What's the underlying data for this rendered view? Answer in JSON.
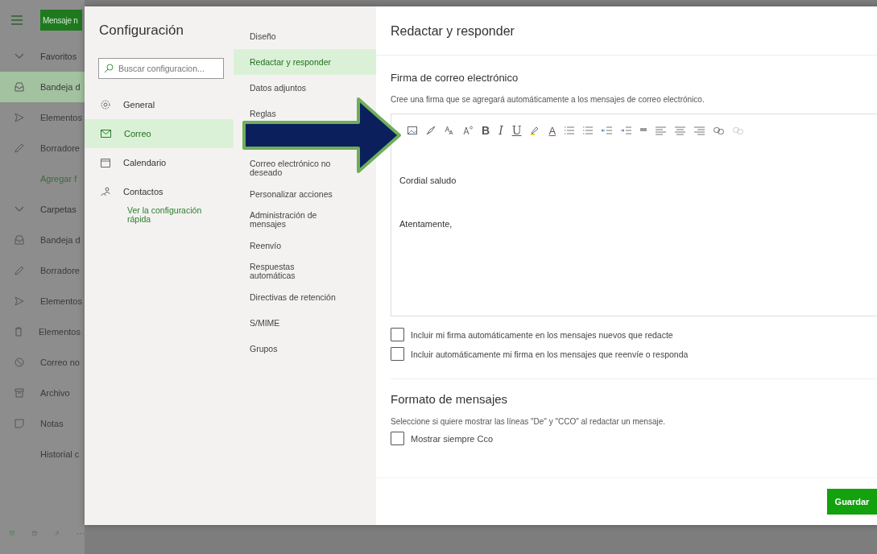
{
  "app": {
    "new_message": "Mensaje n",
    "nav": [
      {
        "kind": "section",
        "label": "Favoritos",
        "selected": false
      },
      {
        "kind": "inbox",
        "label": "Bandeja d",
        "selected": true
      },
      {
        "kind": "sent",
        "label": "Elementos",
        "selected": false
      },
      {
        "kind": "draft",
        "label": "Borradore",
        "selected": false
      },
      {
        "kind": "link",
        "label": "Agregar f",
        "selected": false
      },
      {
        "kind": "section",
        "label": "Carpetas",
        "selected": false
      },
      {
        "kind": "inbox",
        "label": "Bandeja d",
        "selected": false
      },
      {
        "kind": "draft",
        "label": "Borradore",
        "selected": false
      },
      {
        "kind": "sent",
        "label": "Elementos",
        "selected": false
      },
      {
        "kind": "deleted",
        "label": "Elementos",
        "selected": false
      },
      {
        "kind": "junk",
        "label": "Correo no",
        "selected": false
      },
      {
        "kind": "archive",
        "label": "Archivo",
        "selected": false
      },
      {
        "kind": "notes",
        "label": "Notas",
        "selected": false
      },
      {
        "kind": "plain",
        "label": "Historial c",
        "selected": false
      }
    ],
    "bottom_icons": [
      {
        "kind": "mail",
        "selected": true
      },
      {
        "kind": "calendar",
        "selected": false
      },
      {
        "kind": "people",
        "selected": false
      },
      {
        "kind": "more",
        "selected": false
      }
    ],
    "more_label": "···"
  },
  "settings": {
    "title": "Configuración",
    "search": {
      "placeholder": "Buscar configuracion..."
    },
    "categories": [
      {
        "kind": "gear",
        "label": "General",
        "selected": false
      },
      {
        "kind": "mail",
        "label": "Correo",
        "selected": true
      },
      {
        "kind": "calendar",
        "label": "Calendario",
        "selected": false
      },
      {
        "kind": "people",
        "label": "Contactos",
        "selected": false
      }
    ],
    "quick_link": "Ver la configuración rápida",
    "subcategories": [
      {
        "label": "Diseño",
        "selected": false
      },
      {
        "label": "Redactar y responder",
        "selected": true
      },
      {
        "label": "Datos adjuntos",
        "selected": false
      },
      {
        "label": "Reglas",
        "selected": false
      },
      {
        "label": "Correo electrónico no deseado",
        "selected": false
      },
      {
        "label": "Personalizar acciones",
        "selected": false
      },
      {
        "label": "Administración de mensajes",
        "selected": false
      },
      {
        "label": "Reenvío",
        "selected": false
      },
      {
        "label": "Respuestas automáticas",
        "selected": false
      },
      {
        "label": "Directivas de retención",
        "selected": false
      },
      {
        "label": "S/MIME",
        "selected": false
      },
      {
        "label": "Grupos",
        "selected": false
      }
    ]
  },
  "panel": {
    "title": "Redactar y responder",
    "signature": {
      "heading": "Firma de correo electrónico",
      "description": "Cree una firma que se agregará automáticamente a los mensajes de correo electrónico.",
      "toolbar": [
        {
          "kind": "image",
          "disabled": false
        },
        {
          "kind": "brush",
          "disabled": false
        },
        {
          "kind": "fontsize",
          "disabled": false
        },
        {
          "kind": "superscript",
          "disabled": false
        },
        {
          "kind": "bold",
          "label": "B",
          "disabled": false
        },
        {
          "kind": "italic",
          "label": "I",
          "disabled": false
        },
        {
          "kind": "underline",
          "label": "U",
          "disabled": false
        },
        {
          "kind": "highlight",
          "disabled": false
        },
        {
          "kind": "font-color",
          "label": "A",
          "disabled": false
        },
        {
          "kind": "bullets",
          "disabled": false
        },
        {
          "kind": "numbers",
          "disabled": false
        },
        {
          "kind": "outdent",
          "disabled": false
        },
        {
          "kind": "indent",
          "disabled": false
        },
        {
          "kind": "quote",
          "disabled": false
        },
        {
          "kind": "align-left",
          "disabled": false
        },
        {
          "kind": "align-center",
          "disabled": false
        },
        {
          "kind": "align-right",
          "disabled": false
        },
        {
          "kind": "link",
          "disabled": false
        },
        {
          "kind": "link",
          "disabled": true
        }
      ],
      "lines": [
        "Cordial saludo",
        "Atentamente,"
      ],
      "options": [
        {
          "label": "Incluir mi firma automáticamente en los mensajes nuevos que redacte",
          "checked": false
        },
        {
          "label": "Incluir automáticamente mi firma en los mensajes que reenvíe o responda",
          "checked": false
        }
      ]
    },
    "format": {
      "heading": "Formato de mensajes",
      "description": "Seleccione si quiere mostrar las líneas \"De\" y \"CCO\" al redactar un mensaje.",
      "options": [
        {
          "label": "Mostrar siempre Cco",
          "checked": false
        }
      ]
    },
    "save": "Guardar"
  }
}
